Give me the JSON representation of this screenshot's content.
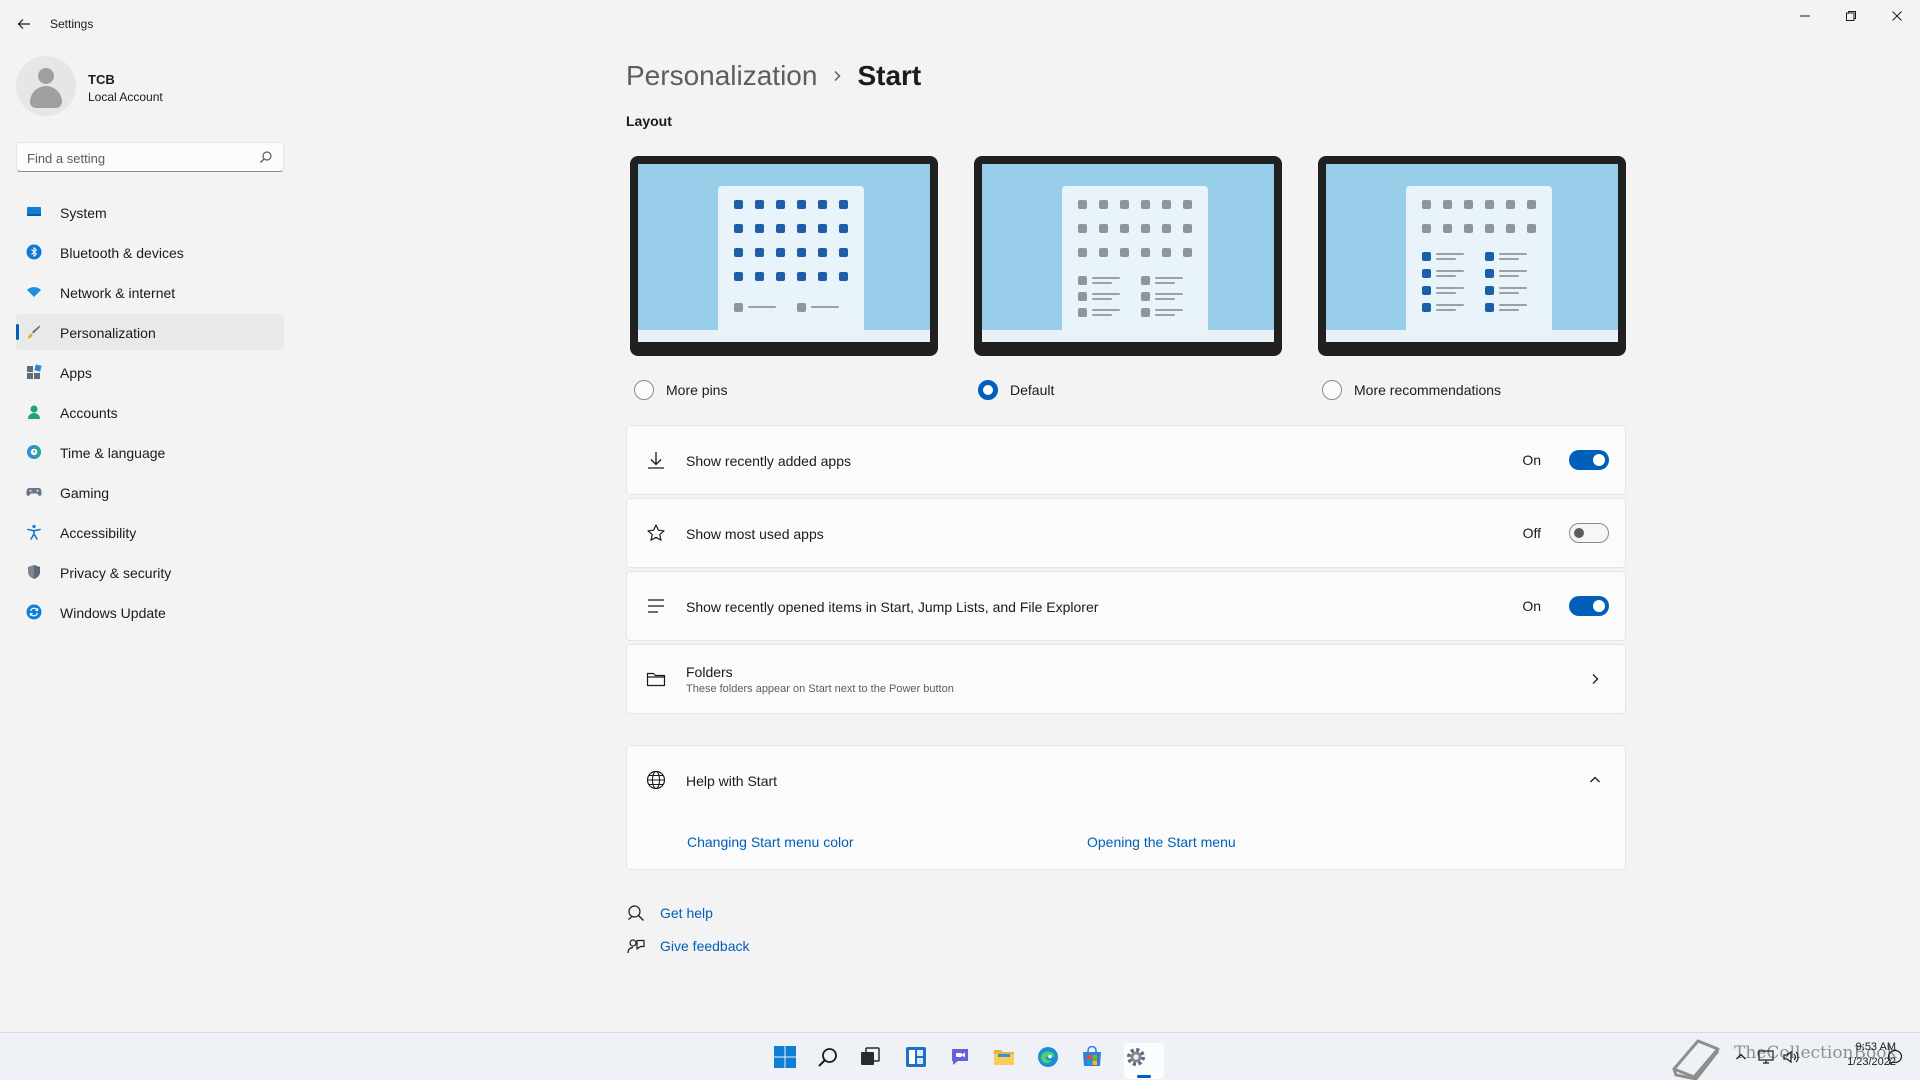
{
  "app": {
    "title": "Settings"
  },
  "profile": {
    "name": "TCB",
    "account_type": "Local Account"
  },
  "search": {
    "placeholder": "Find a setting"
  },
  "sidebar": {
    "items": [
      {
        "label": "System",
        "icon": "monitor-icon",
        "active": false
      },
      {
        "label": "Bluetooth & devices",
        "icon": "bluetooth-icon",
        "active": false
      },
      {
        "label": "Network & internet",
        "icon": "wifi-icon",
        "active": false
      },
      {
        "label": "Personalization",
        "icon": "brush-icon",
        "active": true
      },
      {
        "label": "Apps",
        "icon": "apps-icon",
        "active": false
      },
      {
        "label": "Accounts",
        "icon": "person-icon",
        "active": false
      },
      {
        "label": "Time & language",
        "icon": "globe-clock-icon",
        "active": false
      },
      {
        "label": "Gaming",
        "icon": "gamepad-icon",
        "active": false
      },
      {
        "label": "Accessibility",
        "icon": "accessibility-icon",
        "active": false
      },
      {
        "label": "Privacy & security",
        "icon": "shield-icon",
        "active": false
      },
      {
        "label": "Windows Update",
        "icon": "update-icon",
        "active": false
      }
    ]
  },
  "breadcrumb": {
    "parent": "Personalization",
    "current": "Start"
  },
  "layout": {
    "title": "Layout",
    "options": [
      {
        "label": "More pins",
        "selected": false
      },
      {
        "label": "Default",
        "selected": true
      },
      {
        "label": "More recommendations",
        "selected": false
      }
    ]
  },
  "settings": {
    "recently_added": {
      "label": "Show recently added apps",
      "state": "On"
    },
    "most_used": {
      "label": "Show most used apps",
      "state": "Off"
    },
    "recently_opened": {
      "label": "Show recently opened items in Start, Jump Lists, and File Explorer",
      "state": "On"
    },
    "folders": {
      "label": "Folders",
      "description": "These folders appear on Start next to the Power button"
    }
  },
  "help": {
    "title": "Help with Start",
    "links": [
      "Changing Start menu color",
      "Opening the Start menu"
    ]
  },
  "footer": {
    "get_help": "Get help",
    "give_feedback": "Give feedback"
  },
  "taskbar": {
    "time": "9:53 AM",
    "date": "1/23/2022",
    "watermark": "TheCollectionBook"
  },
  "colors": {
    "accent": "#005fb8",
    "background": "#f3f3f3",
    "card": "#fbfbfb"
  }
}
